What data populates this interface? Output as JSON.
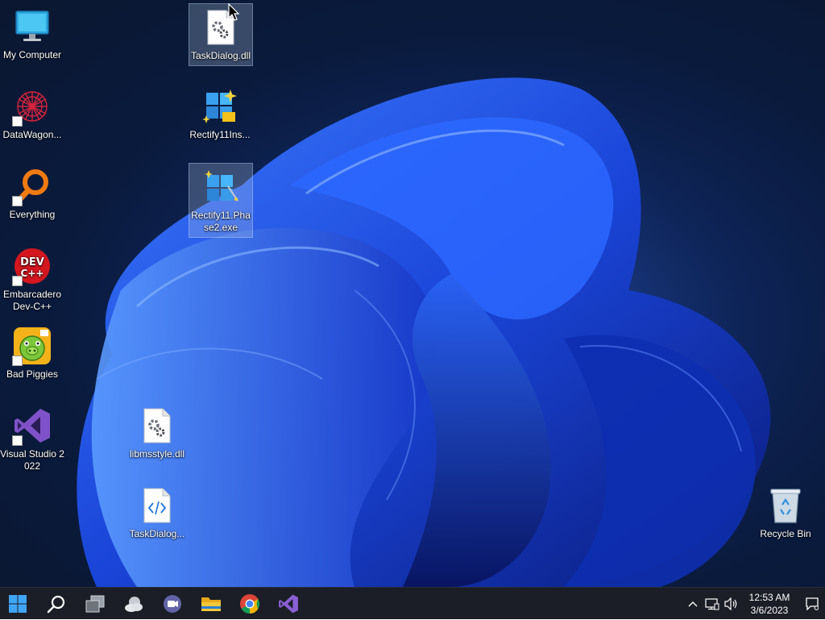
{
  "desktop": {
    "icons": [
      {
        "label": "My Computer",
        "icon": "monitor-icon"
      },
      {
        "label": "DataWagon...",
        "icon": "datawagon-icon"
      },
      {
        "label": "Everything",
        "icon": "everything-search-icon"
      },
      {
        "label": "Embarcadero Dev-C++",
        "icon": "devcpp-icon",
        "badge": "DEV C++"
      },
      {
        "label": "Bad Piggies",
        "icon": "bad-piggies-icon"
      },
      {
        "label": "Visual Studio 2022",
        "icon": "visual-studio-icon"
      },
      {
        "label": "TaskDialog.dll",
        "icon": "dll-file-icon",
        "selected": true
      },
      {
        "label": "Rectify11Ins...",
        "icon": "rectify11-installer-icon"
      },
      {
        "label": "Rectify11.Phase2.exe",
        "icon": "rectify11-exe-icon",
        "selected": true
      },
      {
        "label": "libmsstyle.dll",
        "icon": "dll-file-icon"
      },
      {
        "label": "TaskDialog...",
        "icon": "code-file-icon"
      },
      {
        "label": "Recycle Bin",
        "icon": "recycle-bin-icon"
      }
    ]
  },
  "taskbar": {
    "buttons": [
      {
        "name": "start",
        "icon": "windows-start-icon"
      },
      {
        "name": "search",
        "icon": "search-icon"
      },
      {
        "name": "task-view",
        "icon": "task-view-icon"
      },
      {
        "name": "widgets",
        "icon": "weather-widget-icon"
      },
      {
        "name": "chat",
        "icon": "teams-chat-icon"
      },
      {
        "name": "file-explorer",
        "icon": "folder-icon"
      },
      {
        "name": "chrome",
        "icon": "chrome-icon"
      },
      {
        "name": "visual-studio",
        "icon": "visual-studio-icon"
      }
    ],
    "tray": {
      "overflow_icon": "chevron-up-icon",
      "network_icon": "network-icon",
      "volume_icon": "speaker-icon",
      "time": "12:53 AM",
      "date": "3/6/2023",
      "notification_icon": "notification-icon"
    }
  },
  "colors": {
    "taskbar_bg": "#1b1e26",
    "wallpaper_blue": "#1f4fe0",
    "accent": "#0078d4"
  }
}
